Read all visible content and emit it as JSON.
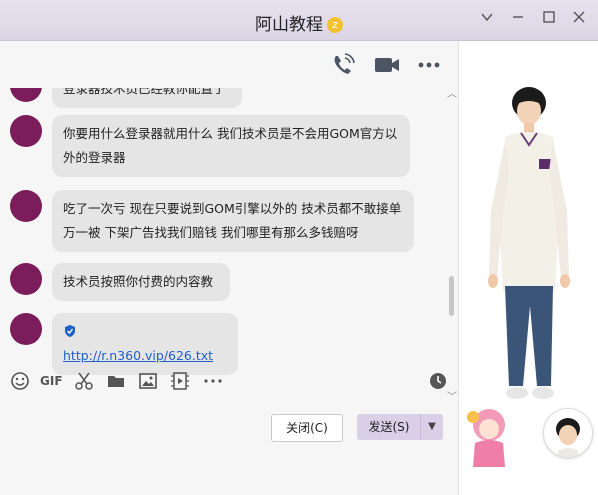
{
  "window": {
    "title": "阿山教程",
    "vip_badge": "z"
  },
  "messages": [
    {
      "text": "登录器技术员已经教你配置了"
    },
    {
      "text": "你要用什么登录器就用什么 我们技术员是不会用GOM官方以外的登录器"
    },
    {
      "text": "吃了一次亏   现在只要说到GOM引擎以外的 技术员都不敢接单  万一被 下架广告找我们赔钱 我们哪里有那么多钱赔呀"
    },
    {
      "text": "技术员按照你付费的内容教"
    },
    {
      "text": "http://r.n360.vip/626.txt"
    }
  ],
  "toolbar": {
    "gif_label": "GIF"
  },
  "buttons": {
    "close": "关闭(C)",
    "send": "发送(S)"
  },
  "colors": {
    "accent": "#d9cfe6",
    "bubble": "#e5e5e5",
    "link": "#1e60c9"
  }
}
